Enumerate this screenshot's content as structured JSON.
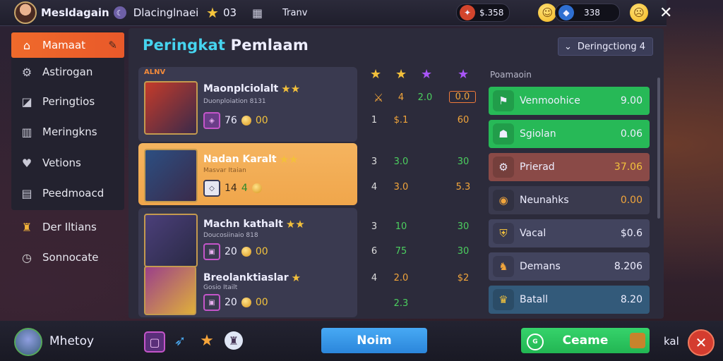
{
  "colors": {
    "accent_orange": "#ef6a2b",
    "title_cyan": "#46d4ef",
    "green_row": "#27b957",
    "red_row": "#8a4a47",
    "blue_button": "#3a9de9",
    "green_button": "#2cc560"
  },
  "topbar": {
    "user_name": "Mesldagain",
    "user_title": "Dlacinglnaei",
    "stars_count": "03",
    "extra_label": "Tranv",
    "currency1": "$.358",
    "currency2": "338"
  },
  "sidebar": {
    "items": [
      {
        "label": "Mamaat",
        "icon": "house-icon"
      },
      {
        "label": "Astirogan",
        "icon": "gear-icon"
      },
      {
        "label": "Peringtios",
        "icon": "chart-icon"
      },
      {
        "label": "Meringkns",
        "icon": "columns-icon"
      },
      {
        "label": "Vetions",
        "icon": "heart-icon"
      },
      {
        "label": "Peedmoacd",
        "icon": "bag-icon"
      }
    ],
    "lower_items": [
      {
        "label": "Der Iltians",
        "icon": "crown-icon"
      },
      {
        "label": "Sonnocate",
        "icon": "timer-icon"
      }
    ]
  },
  "panel": {
    "title_part1": "Peringkat",
    "title_part2": "Pemlaam",
    "sort_label": "Deringctiong 4"
  },
  "leaderboard": {
    "rank_label": "ALNV",
    "players": [
      {
        "name": "Maonplciolalt",
        "subtitle": "Duonploiation 8131",
        "level": "76",
        "coins": "00"
      },
      {
        "name": "Nadan Karalt",
        "subtitle": "Masvar Itaian",
        "level": "14",
        "coins": "4",
        "highlighted": true
      },
      {
        "name": "Machn kathalt",
        "subtitle": "Doucosiinaio 818",
        "level": "20",
        "coins": "00"
      },
      {
        "name": "Breolanktiaslar",
        "subtitle": "Gosio Itailt",
        "level": "20",
        "coins": "00"
      }
    ]
  },
  "stats": {
    "row0": [
      "",
      "4",
      "2.0",
      "0.0"
    ],
    "rows": [
      [
        "1",
        "$.1",
        "60"
      ],
      [
        "3",
        "3.0",
        "30"
      ],
      [
        "4",
        "3.0",
        "5.3"
      ],
      [
        "3",
        "10",
        "30"
      ],
      [
        "6",
        "75",
        "30"
      ],
      [
        "4",
        "2.0",
        "$2"
      ],
      [
        "",
        "2.3",
        ""
      ]
    ]
  },
  "ranks": {
    "title": "Poamaoin",
    "rows": [
      {
        "name": "Venmoohice",
        "value": "9.00",
        "style": "green"
      },
      {
        "name": "Sgiolan",
        "value": "0.06",
        "style": "green"
      },
      {
        "name": "Prierad",
        "value": "37.06",
        "style": "red"
      },
      {
        "name": "Neunahks",
        "value": "0.00",
        "style": "dark"
      },
      {
        "name": "Vacal",
        "value": "$0.6",
        "style": "slate"
      },
      {
        "name": "Demans",
        "value": "8.206",
        "style": "slate"
      },
      {
        "name": "Batall",
        "value": "8.20",
        "style": "blue"
      }
    ]
  },
  "bottombar": {
    "user_name": "Mhetoy",
    "now_label": "Noim",
    "create_label": "Ceame",
    "edge_label": "kal"
  }
}
